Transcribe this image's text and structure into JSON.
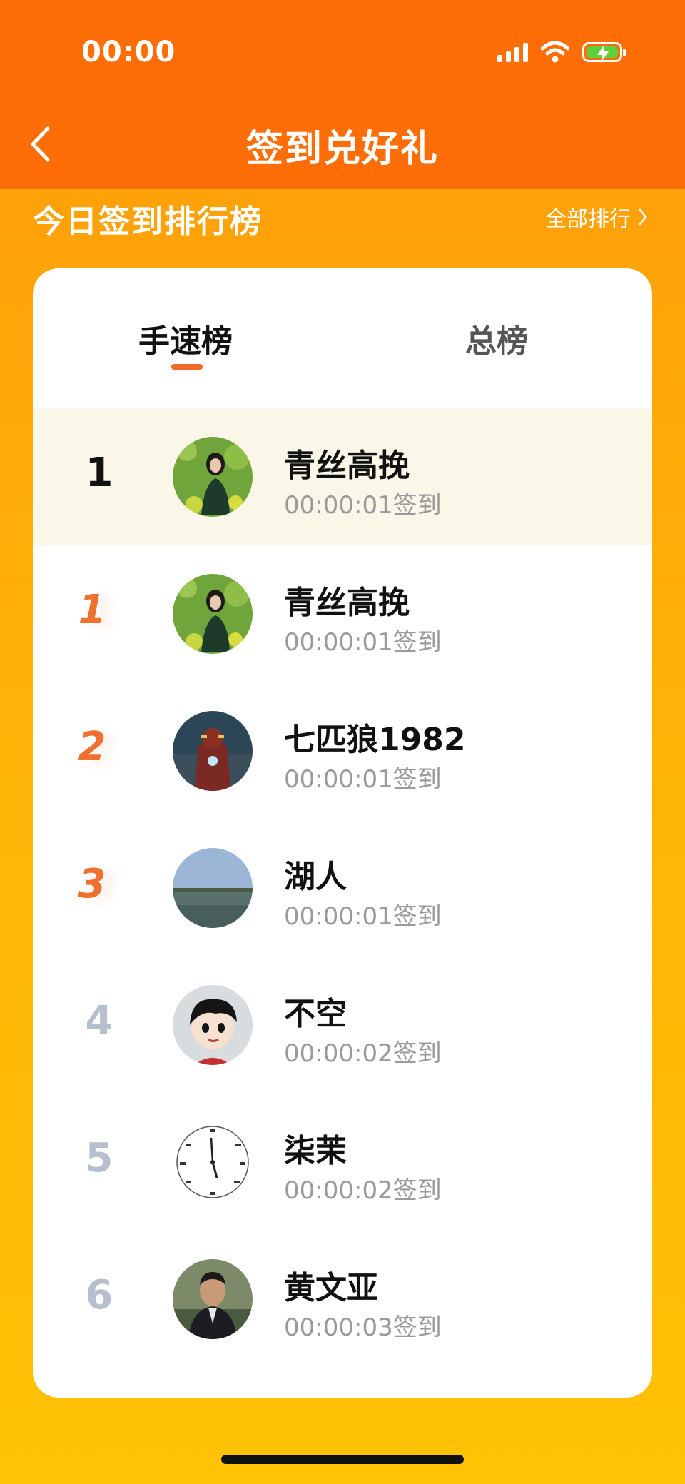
{
  "status_bar": {
    "time": "00:00"
  },
  "nav": {
    "title": "签到兑好礼"
  },
  "section": {
    "title": "今日签到排行榜",
    "all_rank_label": "全部排行"
  },
  "tabs": [
    {
      "label": "手速榜",
      "active": true
    },
    {
      "label": "总榜",
      "active": false
    }
  ],
  "rows": [
    {
      "rank": "1",
      "name": "青丝高挽",
      "time": "00:00:01签到",
      "avatar": "woman-in-field"
    },
    {
      "rank": "1",
      "name": "青丝高挽",
      "time": "00:00:01签到",
      "avatar": "woman-in-field"
    },
    {
      "rank": "2",
      "name": "七匹狼1982",
      "time": "00:00:01签到",
      "avatar": "iron-man"
    },
    {
      "rank": "3",
      "name": "湖人",
      "time": "00:00:01签到",
      "avatar": "lake-view"
    },
    {
      "rank": "4",
      "name": "不空",
      "time": "00:00:02签到",
      "avatar": "cartoon-boy"
    },
    {
      "rank": "5",
      "name": "柒茉",
      "time": "00:00:02签到",
      "avatar": "clock-sketch"
    },
    {
      "rank": "6",
      "name": "黄文亚",
      "time": "00:00:03签到",
      "avatar": "man-portrait"
    }
  ],
  "colors": {
    "top_bar": "#ff6d06",
    "page_gradient_start": "#ff9a0a",
    "page_gradient_end": "#ffc205",
    "accent": "#f2692b",
    "highlight_row": "#fbf7e8",
    "medal_rank": "#f07030",
    "gray_rank": "#b5bfcd"
  }
}
